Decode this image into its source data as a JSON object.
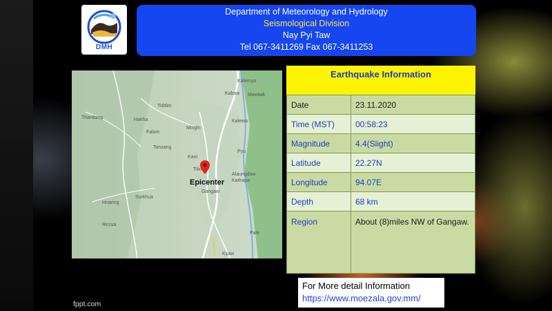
{
  "header": {
    "line1": "Department of Meteorology and Hydrology",
    "line2": "Seismological Division",
    "line3": "Nay Pyi Taw",
    "line4": "Tel 067-3411269 Fax 067-3411253"
  },
  "logo": {
    "text": "DMH"
  },
  "map": {
    "marker_label": "Epicenter",
    "marker_icon": "map-pin-icon",
    "marker_color": "#e2231a",
    "places": [
      "Thantlang",
      "Hakha",
      "Falam",
      "Kalemyo",
      "Tiddim",
      "Mawlaik",
      "Kalewa",
      "Gangaw",
      "Pale",
      "Kyaw",
      "Mingin",
      "Kani",
      "Pyu",
      "Kabaw",
      "Tonzang",
      "Surkhua",
      "Hnaring",
      "Rezua",
      "Tilin",
      "Alaungdaw Kathapa"
    ]
  },
  "info": {
    "title": "Earthquake Information",
    "rows": [
      {
        "key": "Date",
        "value": "23.11.2020"
      },
      {
        "key": "Time (MST)",
        "value": "00:58:23"
      },
      {
        "key": "Magnitude",
        "value": "4.4(Slight)"
      },
      {
        "key": "Latitude",
        "value": "22.27N"
      },
      {
        "key": "Longitude",
        "value": "94.07E"
      },
      {
        "key": "Depth",
        "value": "68 km"
      },
      {
        "key": "Region",
        "value": "About (8)miles NW of Gangaw."
      }
    ]
  },
  "more": {
    "label": "For More detail Information",
    "url": "https://www.moezala.gov.mm/"
  },
  "footer": {
    "credit": "fppt.com"
  },
  "colors": {
    "header_bg": "#1546f0",
    "title_bg": "#fff400",
    "row_dark": "#c9dba3",
    "row_light": "#e6f0d4"
  }
}
